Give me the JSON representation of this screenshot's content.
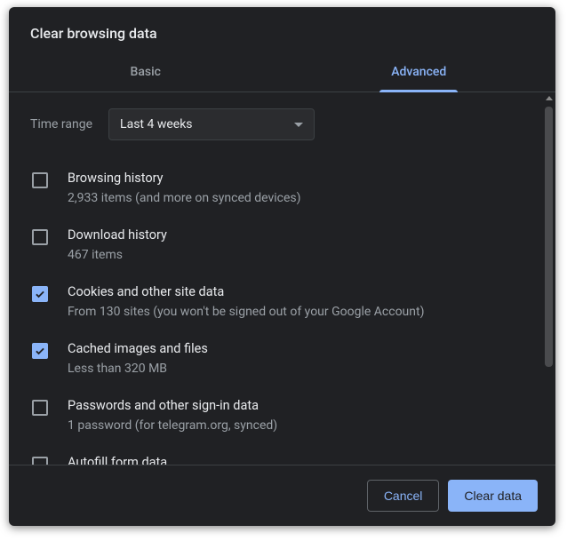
{
  "dialog": {
    "title": "Clear browsing data"
  },
  "tabs": {
    "basic": "Basic",
    "advanced": "Advanced"
  },
  "time_range": {
    "label": "Time range",
    "selected": "Last 4 weeks"
  },
  "items": [
    {
      "title": "Browsing history",
      "desc": "2,933 items (and more on synced devices)",
      "checked": false
    },
    {
      "title": "Download history",
      "desc": "467 items",
      "checked": false
    },
    {
      "title": "Cookies and other site data",
      "desc": "From 130 sites (you won't be signed out of your Google Account)",
      "checked": true
    },
    {
      "title": "Cached images and files",
      "desc": "Less than 320 MB",
      "checked": true
    },
    {
      "title": "Passwords and other sign-in data",
      "desc": "1 password (for telegram.org, synced)",
      "checked": false
    },
    {
      "title": "Autofill form data",
      "desc": "",
      "checked": false
    }
  ],
  "footer": {
    "cancel": "Cancel",
    "clear": "Clear data"
  }
}
